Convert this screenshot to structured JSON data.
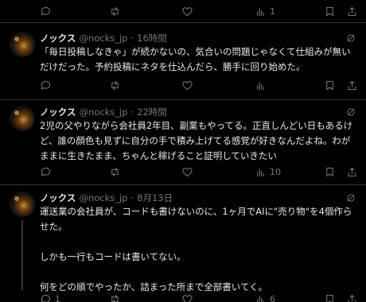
{
  "top_actions": {
    "reply_count": "",
    "retweet_count": "",
    "like_count": "",
    "views_count": "1"
  },
  "tweets": [
    {
      "name": "ノックス",
      "handle": "@nocks_jp",
      "separator": "·",
      "time": "16時間",
      "text": "「毎日投稿しなきゃ」が続かないの、気合いの問題じゃなくて仕組みが無いだけだった。予約投稿にネタを仕込んだら、勝手に回り始めた。",
      "reply_count": "",
      "retweet_count": "",
      "like_count": "",
      "views_count": ""
    },
    {
      "name": "ノックス",
      "handle": "@nocks_jp",
      "separator": "·",
      "time": "22時間",
      "text": "2児の父やりながら会社員2年目、副業もやってる。正直しんどい日もあるけど、誰の顔色も見ずに自分の手で積み上げてる感覚が好きなんだよね。わがままに生きたまま、ちゃんと稼げること証明していきたい",
      "reply_count": "",
      "retweet_count": "",
      "like_count": "",
      "views_count": "10"
    },
    {
      "name": "ノックス",
      "handle": "@nocks_jp",
      "separator": "·",
      "time": "8月13日",
      "text": "運送業の会社員が、コードも書けないのに、1ヶ月でAIに\"売り物\"を4個作らせた。\n\nしかも一行もコードは書いてない。\n\n何をどの順でやったか、詰まった所まで全部書いてく。",
      "reply_count": "1",
      "retweet_count": "",
      "like_count": "",
      "views_count": "6"
    }
  ]
}
